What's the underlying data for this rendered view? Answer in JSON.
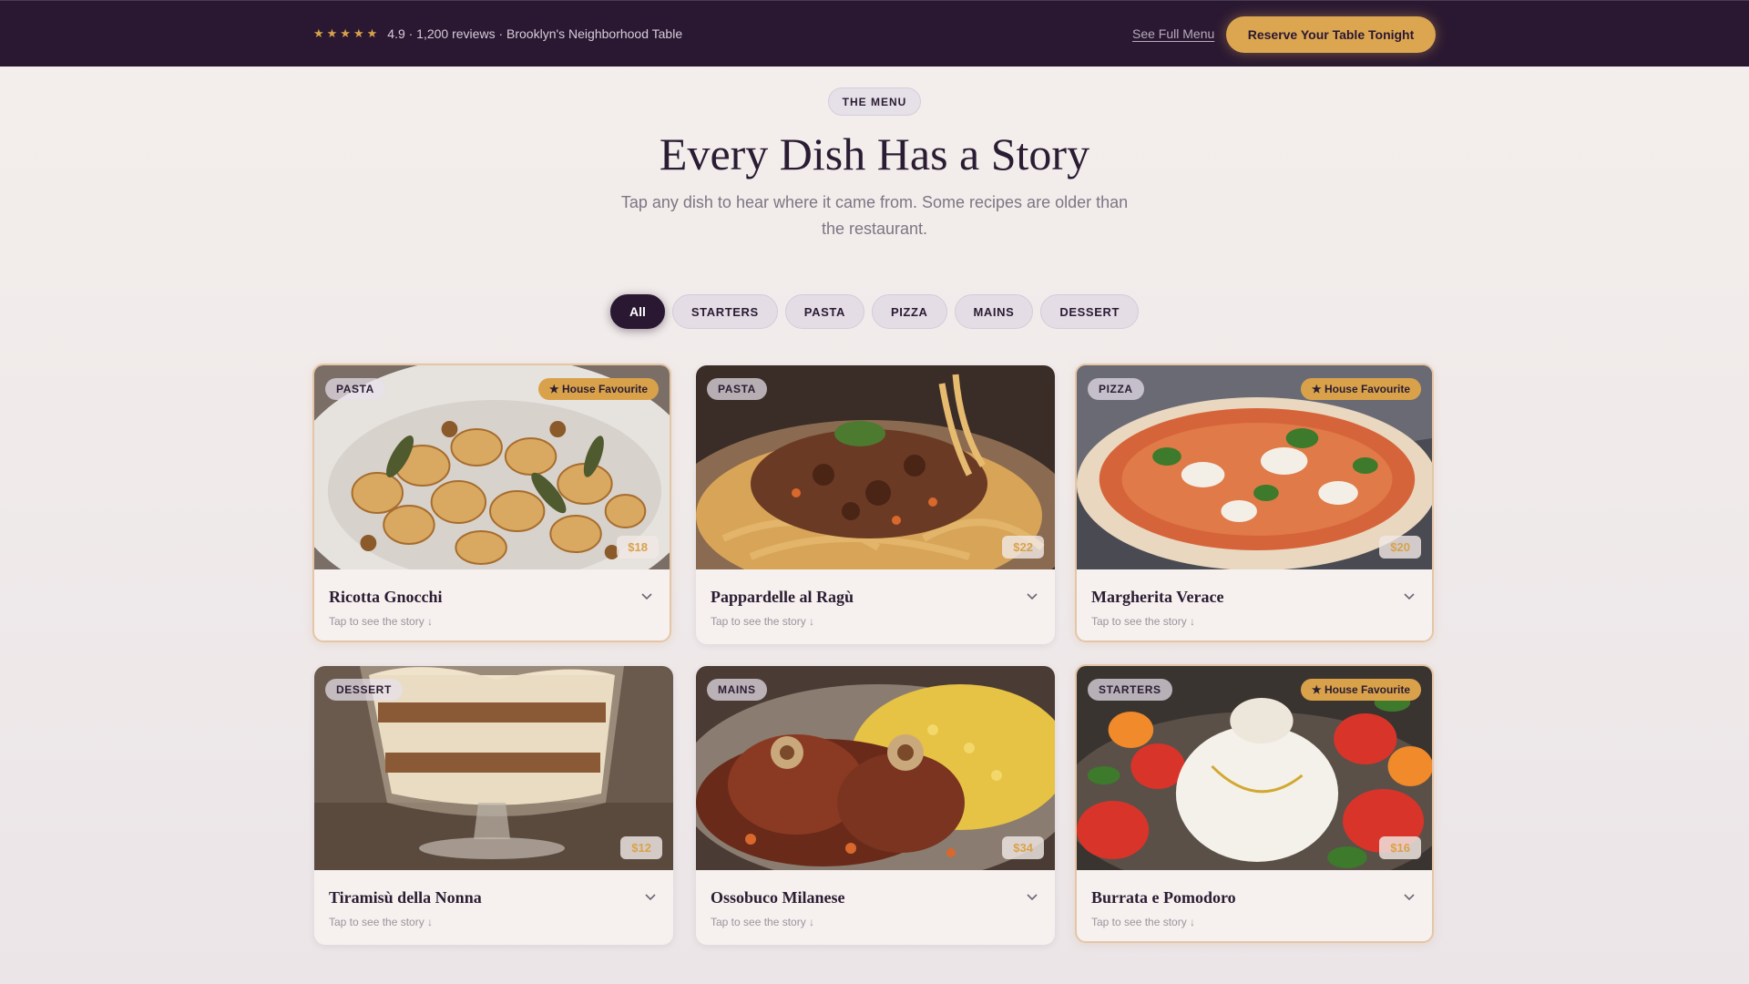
{
  "topbar": {
    "stars": "★★★★★",
    "rating_text": "4.9 · 1,200 reviews · Brooklyn's Neighborhood Table",
    "see_menu_label": "See Full Menu",
    "reserve_label": "Reserve Your Table Tonight"
  },
  "header": {
    "eyebrow": "THE MENU",
    "title": "Every Dish Has a Story",
    "subtitle": "Tap any dish to hear where it came from. Some recipes are older than the restaurant."
  },
  "filters": [
    "All",
    "STARTERS",
    "PASTA",
    "PIZZA",
    "MAINS",
    "DESSERT"
  ],
  "active_filter": "All",
  "fav_label": "★ House Favourite",
  "hint": "Tap to see the story ↓",
  "colors": {
    "topbar": "#2a1832",
    "accent_gold": "#d9a24a",
    "text_dark": "#2a1c33"
  },
  "dishes": [
    {
      "category": "PASTA",
      "name": "Ricotta Gnocchi",
      "price": "$18",
      "favourite": true
    },
    {
      "category": "PASTA",
      "name": "Pappardelle al Ragù",
      "price": "$22",
      "favourite": false
    },
    {
      "category": "PIZZA",
      "name": "Margherita Verace",
      "price": "$20",
      "favourite": true
    },
    {
      "category": "DESSERT",
      "name": "Tiramisù della Nonna",
      "price": "$12",
      "favourite": false
    },
    {
      "category": "MAINS",
      "name": "Ossobuco Milanese",
      "price": "$34",
      "favourite": false
    },
    {
      "category": "STARTERS",
      "name": "Burrata e Pomodoro",
      "price": "$16",
      "favourite": true
    }
  ]
}
